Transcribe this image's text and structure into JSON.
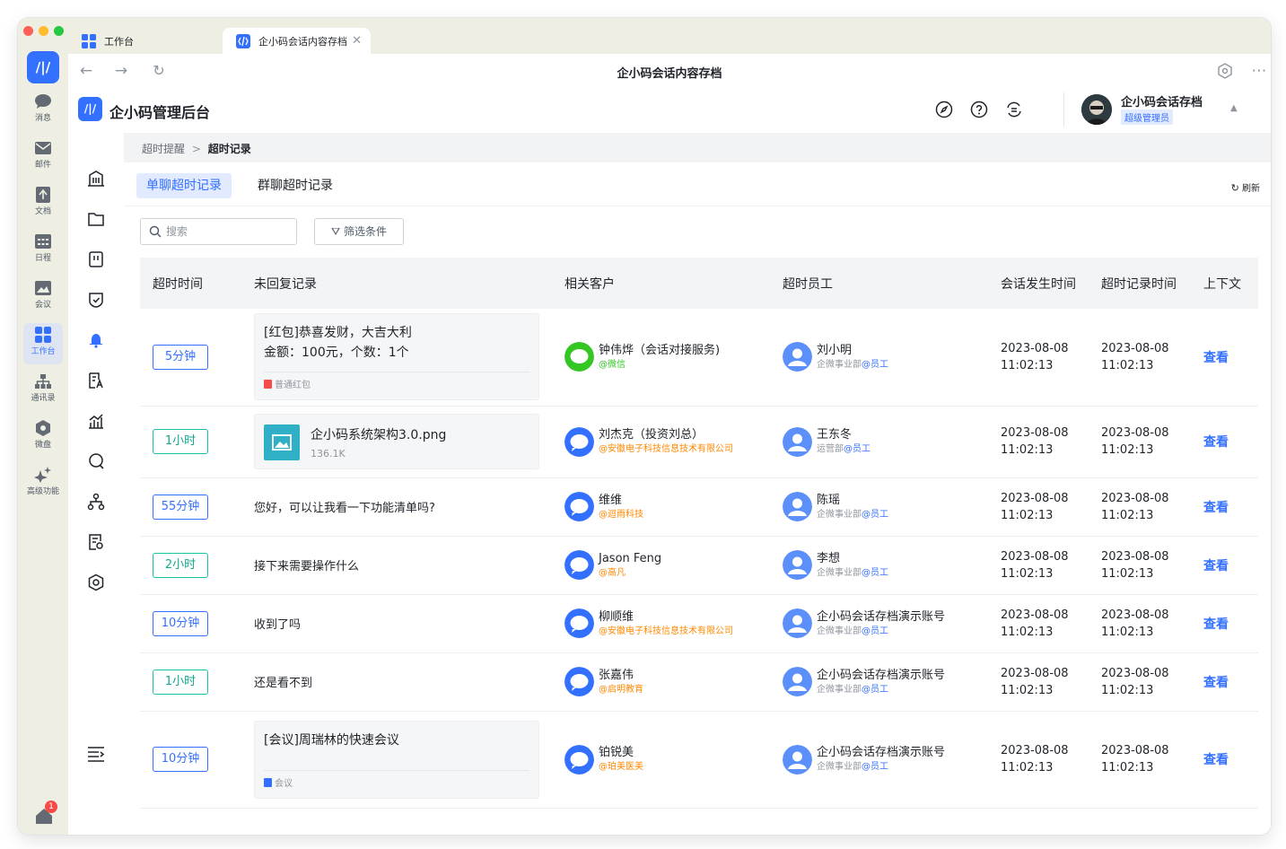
{
  "browser": {
    "tabs": [
      {
        "label": "工作台",
        "icon": "grid-icon"
      },
      {
        "label": "企小码会话内容存档",
        "icon": "app-icon",
        "active": true
      }
    ],
    "page_title": "企小码会话内容存档"
  },
  "rail": {
    "logo": "/|/",
    "items": [
      {
        "label": "消息",
        "icon": "chat-icon"
      },
      {
        "label": "邮件",
        "icon": "mail-icon"
      },
      {
        "label": "文档",
        "icon": "doc-icon"
      },
      {
        "label": "日程",
        "icon": "calendar-icon"
      },
      {
        "label": "会议",
        "icon": "meeting-icon"
      },
      {
        "label": "工作台",
        "icon": "workbench-icon",
        "active": true
      },
      {
        "label": "通讯录",
        "icon": "contacts-icon"
      },
      {
        "label": "微盘",
        "icon": "drive-icon"
      },
      {
        "label": "高级功能",
        "icon": "sparkle-icon"
      }
    ],
    "notification_count": "1"
  },
  "header": {
    "logo": "/|/",
    "title": "企小码管理后台",
    "user_name": "企小码会话存档",
    "user_role": "超级管理员"
  },
  "breadcrumb": {
    "parent": "超时提醒",
    "separator": ">",
    "current": "超时记录"
  },
  "tabs": {
    "single": "单聊超时记录",
    "group": "群聊超时记录",
    "refresh": "刷新"
  },
  "toolbar": {
    "search_placeholder": "搜索",
    "filter_label": "筛选条件"
  },
  "table": {
    "columns": [
      "超时时间",
      "未回复记录",
      "相关客户",
      "超时员工",
      "会话发生时间",
      "超时记录时间",
      "上下文"
    ],
    "action_label": "查看",
    "rows": [
      {
        "duration": "5分钟",
        "duration_style": "blue",
        "message_type": "card",
        "message": "[红包]恭喜发财，大吉大利",
        "message_line2": "金额：100元，个数：1个",
        "message_footer": "普通红包",
        "customer": "钟伟烨（会话对接服务)",
        "customer_sub": "@微信",
        "customer_sub_color": "green",
        "employee": "刘小明",
        "employee_dept": "企微事业部",
        "employee_tag": "@员工",
        "session_time_date": "2023-08-08",
        "session_time_clock": "11:02:13",
        "record_time_date": "2023-08-08",
        "record_time_clock": "11:02:13"
      },
      {
        "duration": "1小时",
        "duration_style": "green",
        "message_type": "file",
        "file_name": "企小码系统架构3.0.png",
        "file_size": "136.1K",
        "customer": "刘杰克（投资刘总）",
        "customer_sub": "@安徽电子科技信息技术有限公司",
        "customer_sub_color": "orange",
        "employee": "王东冬",
        "employee_dept": "运营部",
        "employee_tag": "@员工",
        "session_time_date": "2023-08-08",
        "session_time_clock": "11:02:13",
        "record_time_date": "2023-08-08",
        "record_time_clock": "11:02:13"
      },
      {
        "duration": "55分钟",
        "duration_style": "blue",
        "message_type": "text",
        "message": "您好，可以让我看一下功能清单吗?",
        "customer": "维维",
        "customer_sub": "@迴雨科技",
        "customer_sub_color": "orange",
        "employee": "陈瑶",
        "employee_dept": "企微事业部",
        "employee_tag": "@员工",
        "session_time_date": "2023-08-08",
        "session_time_clock": "11:02:13",
        "record_time_date": "2023-08-08",
        "record_time_clock": "11:02:13"
      },
      {
        "duration": "2小时",
        "duration_style": "green",
        "message_type": "text",
        "message": "接下来需要操作什么",
        "customer": "Jason Feng",
        "customer_sub": "@高凡",
        "customer_sub_color": "orange",
        "employee": "李想",
        "employee_dept": "企微事业部",
        "employee_tag": "@员工",
        "session_time_date": "2023-08-08",
        "session_time_clock": "11:02:13",
        "record_time_date": "2023-08-08",
        "record_time_clock": "11:02:13"
      },
      {
        "duration": "10分钟",
        "duration_style": "blue",
        "message_type": "text",
        "message": "收到了吗",
        "customer": "柳顺维",
        "customer_sub": "@安徽电子科技信息技术有限公司",
        "customer_sub_color": "orange",
        "employee": "企小码会话存档演示账号",
        "employee_dept": "企微事业部",
        "employee_tag": "@员工",
        "session_time_date": "2023-08-08",
        "session_time_clock": "11:02:13",
        "record_time_date": "2023-08-08",
        "record_time_clock": "11:02:13"
      },
      {
        "duration": "1小时",
        "duration_style": "green",
        "message_type": "text",
        "message": "还是看不到",
        "customer": "张嘉伟",
        "customer_sub": "@启明教育",
        "customer_sub_color": "orange",
        "employee": "企小码会话存档演示账号",
        "employee_dept": "企微事业部",
        "employee_tag": "@员工",
        "session_time_date": "2023-08-08",
        "session_time_clock": "11:02:13",
        "record_time_date": "2023-08-08",
        "record_time_clock": "11:02:13"
      },
      {
        "duration": "10分钟",
        "duration_style": "blue",
        "message_type": "card",
        "message": "[会议]周瑞林的快速会议",
        "message_line2": "",
        "message_footer": "会议",
        "customer": "铂锐美",
        "customer_sub": "@珀美医美",
        "customer_sub_color": "orange",
        "employee": "企小码会话存档演示账号",
        "employee_dept": "企微事业部",
        "employee_tag": "@员工",
        "session_time_date": "2023-08-08",
        "session_time_clock": "11:02:13",
        "record_time_date": "2023-08-08",
        "record_time_clock": "11:02:13"
      }
    ]
  },
  "colors": {
    "accent": "#3370ff",
    "green": "#18c2a5",
    "orange": "#ff8800",
    "wechat_green": "#34c724"
  }
}
